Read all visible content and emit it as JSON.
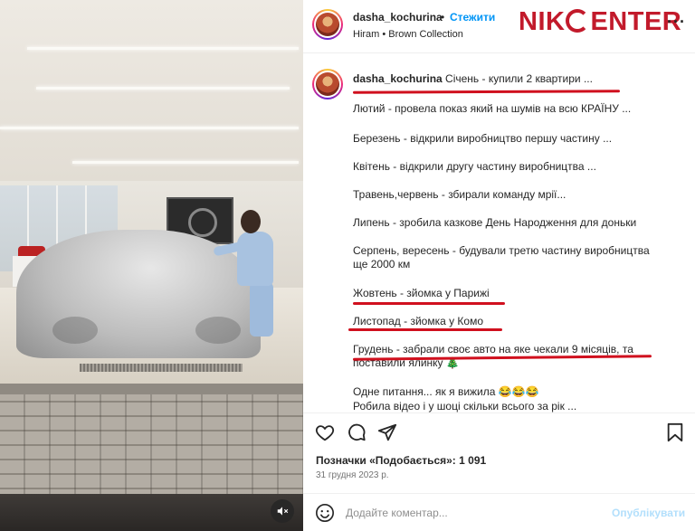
{
  "post": {
    "username": "dasha_kochurina",
    "dot": "•",
    "follow_label": "Стежити",
    "location": "Hiram • Brown Collection",
    "watermark_logo": "NIKCENTER",
    "more_icon": "more-horizontal-icon"
  },
  "caption": {
    "username": "dasha_kochurina",
    "first_line": "Січень - купили 2 квартири ...",
    "lines": [
      "Лютий - провела показ який на шумів на всю КРАЇНУ ...",
      "Березень - відкрили виробництво першу частину ...",
      "Квітень - відкрили другу частину виробництва ...",
      "Травень,червень - збирали команду мрії...",
      "Липень - зробила казкове День Народження для доньки",
      "Серпень, вересень - будували третю частину виробництва ще 2000 км",
      "Жовтень - зйомка у Парижі",
      "Листопад - зйомка у Комо",
      "Грудень - забрали своє авто на яке чекали 9 місяців, та поставили ялинку 🎄",
      "Одне питання... як я вижила 😂😂😂",
      "Робила відео і у шоці скільки всього за рік ..."
    ]
  },
  "actions": {
    "like_icon": "heart-icon",
    "comment_icon": "comment-icon",
    "share_icon": "send-icon",
    "save_icon": "bookmark-icon"
  },
  "likes_text": "Позначки «Подобається»: 1 091",
  "date_text": "31 грудня 2023 р.",
  "comment_box": {
    "placeholder": "Додайте коментар...",
    "publish_label": "Опублікувати"
  },
  "colors": {
    "accent_blue": "#0095f6",
    "logo_red": "#c21a2b",
    "underline_red": "#d0101e"
  }
}
